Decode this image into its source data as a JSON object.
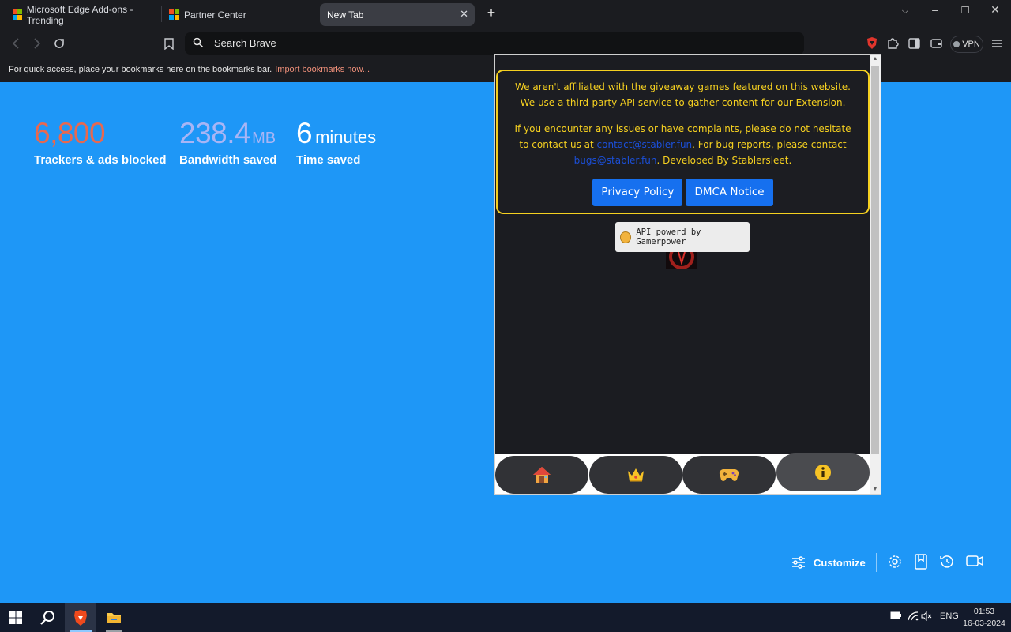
{
  "tabs": [
    {
      "title": "Microsoft Edge Add-ons - Trending",
      "active": false
    },
    {
      "title": "Partner Center",
      "active": false
    },
    {
      "title": "New Tab",
      "active": true
    }
  ],
  "toolbar": {
    "search_text": "Search Brave",
    "vpn_label": "VPN"
  },
  "bookmarks_bar": {
    "message": "For quick access, place your bookmarks here on the bookmarks bar.",
    "import_link": "Import bookmarks now..."
  },
  "stats": [
    {
      "value": "6,800",
      "unit": "",
      "label": "Trackers & ads blocked",
      "color": "#e8684f"
    },
    {
      "value": "238.4",
      "unit": "MB",
      "label": "Bandwidth saved",
      "color": "#a8b5f5"
    },
    {
      "value": "6",
      "unit": "minutes",
      "label": "Time saved",
      "color": "#ffffff"
    }
  ],
  "ntp": {
    "customize_label": "Customize",
    "background_color": "#1e97f7"
  },
  "popup": {
    "notice_line1": "We aren't affiliated with the giveaway games featured on this website. We use a third-party API service to gather content for our Extension.",
    "notice_line2_a": "If you encounter any issues or have complaints, please do not hesitate to contact us at ",
    "contact_email": "contact@stabler.fun",
    "notice_line2_b": ". For bug reports, please contact ",
    "bug_email": "bugs@stabler.fun",
    "notice_line2_c": ". Developed By Stablersleet.",
    "privacy_button": "Privacy Policy",
    "dmca_button": "DMCA Notice",
    "api_badge": "API powerd by Gamerpower",
    "nav": [
      {
        "icon": "house-icon",
        "glyph": "🏠"
      },
      {
        "icon": "crown-icon",
        "glyph": "👑"
      },
      {
        "icon": "gamepad-icon",
        "glyph": "🎮"
      },
      {
        "icon": "info-icon",
        "glyph": "ℹ"
      }
    ]
  },
  "taskbar": {
    "language": "ENG",
    "time": "01:53",
    "date": "16-03-2024"
  }
}
